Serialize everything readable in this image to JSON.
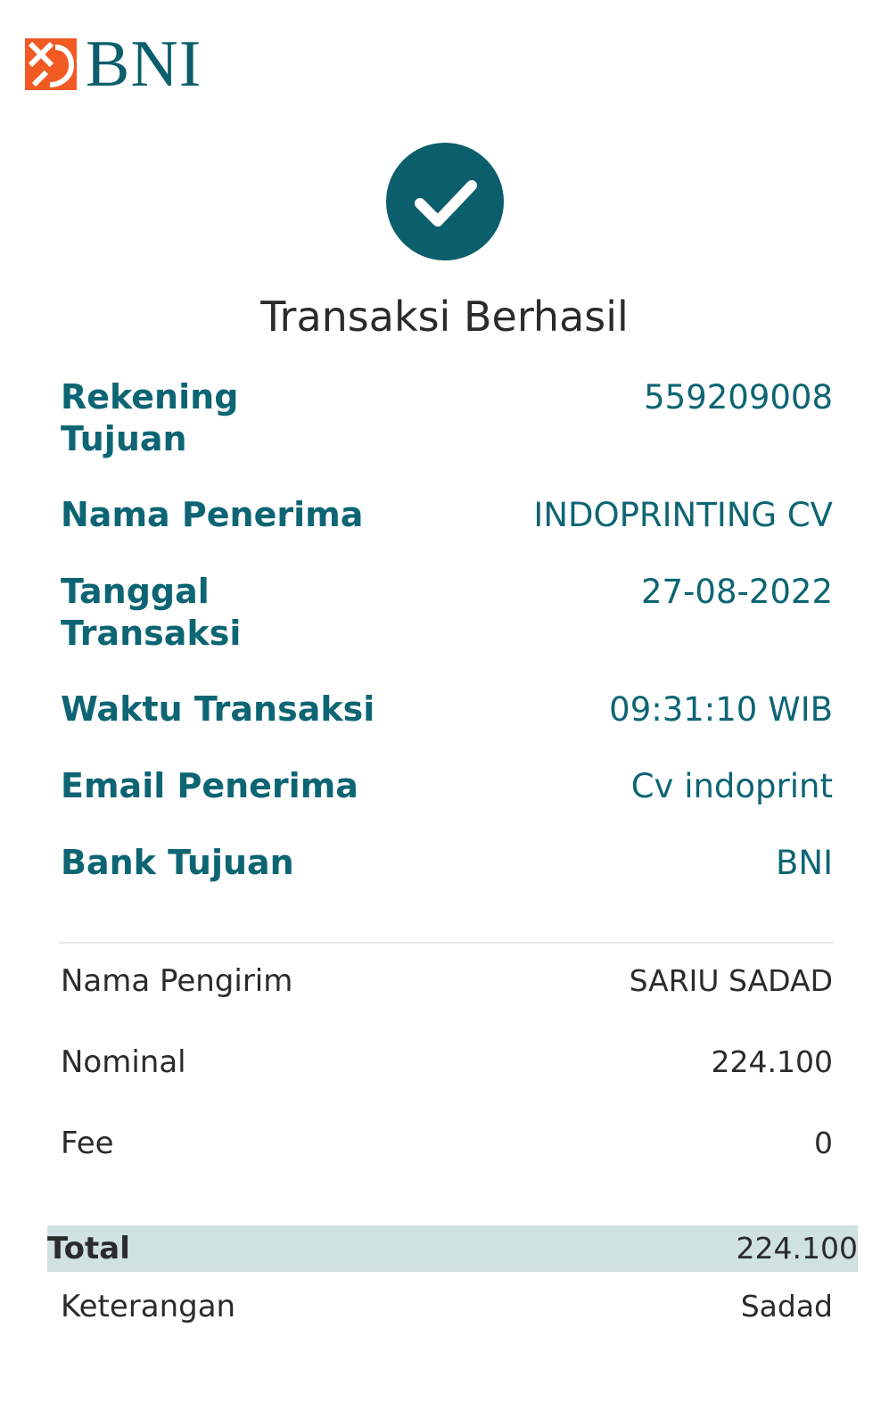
{
  "bank": {
    "name": "BNI",
    "logo_icon": "bni-logo-icon",
    "brand_color": "#0b5e6b",
    "accent_color": "#f15a22"
  },
  "status": {
    "icon": "check-circle-icon",
    "icon_color": "#0b5e6b",
    "title": "Transaksi Berhasil"
  },
  "details": [
    {
      "label": "Rekening Tujuan",
      "value": "559209008"
    },
    {
      "label": "Nama Penerima",
      "value": "INDOPRINTING CV"
    },
    {
      "label": "Tanggal Transaksi",
      "value": "27-08-2022"
    },
    {
      "label": "Waktu Transaksi",
      "value": "09:31:10 WIB"
    },
    {
      "label": "Email Penerima",
      "value": "Cv indoprint"
    },
    {
      "label": "Bank Tujuan",
      "value": "BNI"
    }
  ],
  "summary": [
    {
      "label": "Nama Pengirim",
      "value": "SARIU SADAD"
    },
    {
      "label": "Nominal",
      "value": "224.100"
    },
    {
      "label": "Fee",
      "value": "0"
    }
  ],
  "total": {
    "label": "Total",
    "value": "224.100",
    "highlight_color": "#cfe1e1"
  },
  "note": {
    "label": "Keterangan",
    "value": "Sadad"
  }
}
